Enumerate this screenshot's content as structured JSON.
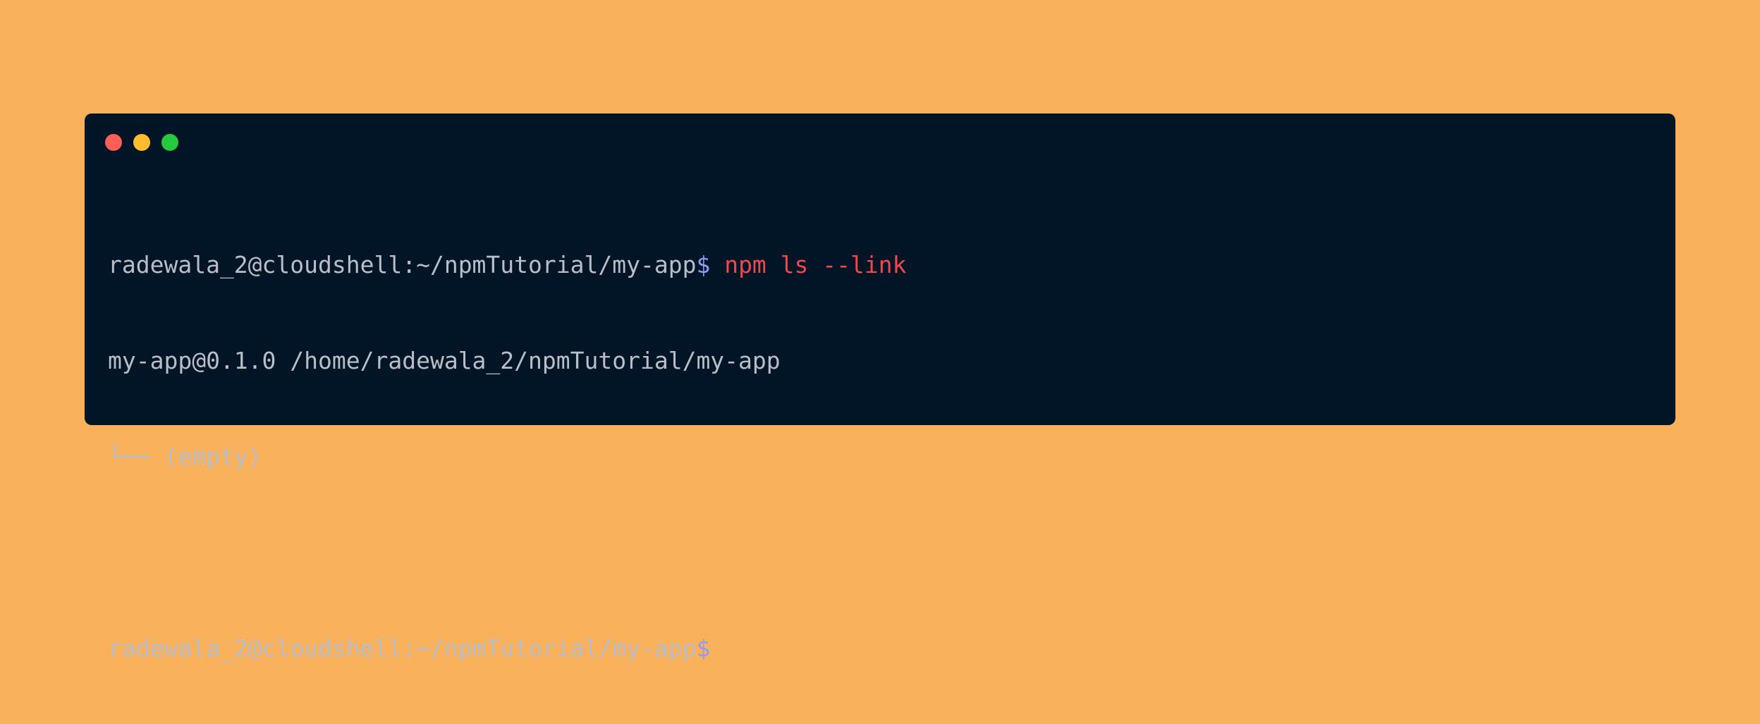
{
  "window": {
    "controls": [
      {
        "name": "close",
        "color": "#ff5f56"
      },
      {
        "name": "minimize",
        "color": "#ffbd2e"
      },
      {
        "name": "maximize",
        "color": "#27c93f"
      }
    ]
  },
  "terminal": {
    "line1": {
      "prompt": "radewala_2@cloudshell:~/npmTutorial/my-app",
      "symbol": "$",
      "command": " npm ls --link"
    },
    "line2": "my-app@0.1.0 /home/radewala_2/npmTutorial/my-app",
    "line3": "└── (empty)",
    "line5": {
      "prompt": "radewala_2@cloudshell:~/npmTutorial/my-app",
      "symbol": "$"
    }
  },
  "colors": {
    "background": "#fab15c",
    "terminal_bg": "#011526",
    "text": "#b9bec9",
    "prompt_symbol": "#8f9cf5",
    "command": "#f2484b"
  }
}
